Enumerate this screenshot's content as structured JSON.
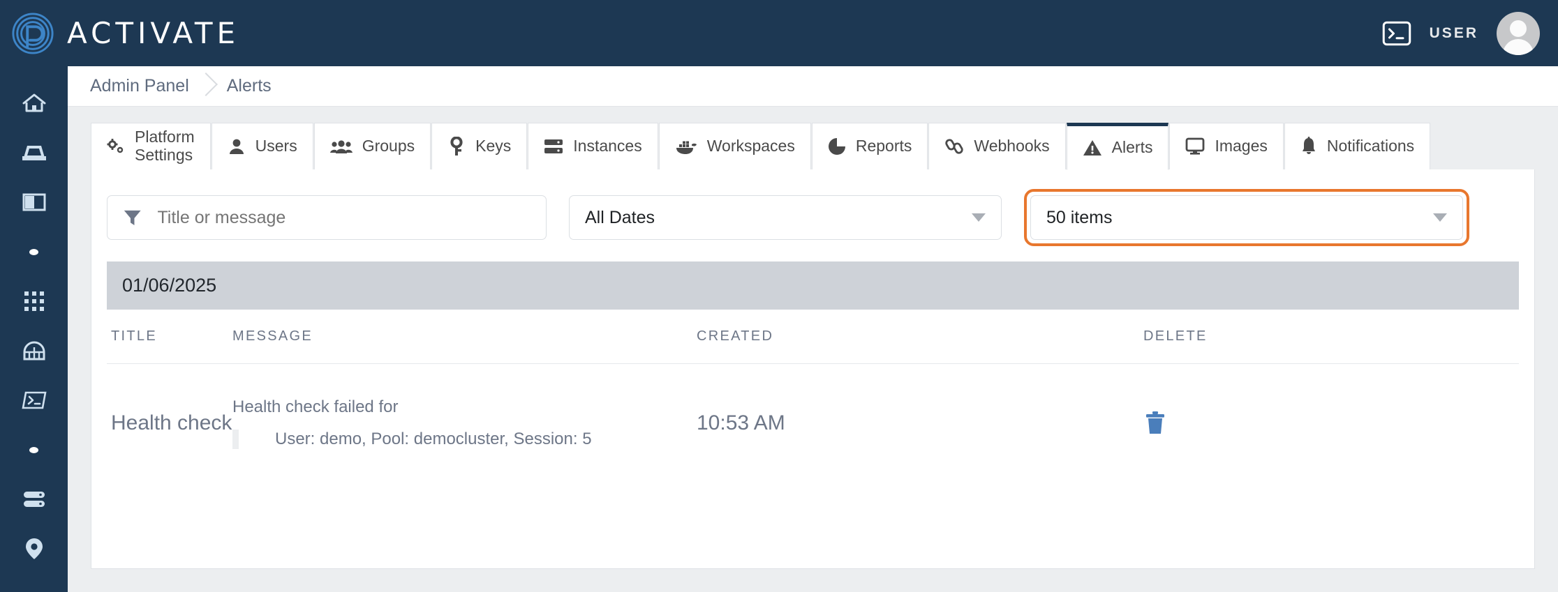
{
  "header": {
    "brand_name": "ACTIVATE",
    "logo_icon": "fingerprint-p-logo",
    "terminal_icon": "terminal-icon",
    "user_label": "USER",
    "avatar_icon": "user-avatar"
  },
  "sidebar": {
    "items": [
      {
        "name": "home",
        "icon": "home-icon"
      },
      {
        "name": "inbox",
        "icon": "inbox-tray-icon"
      },
      {
        "name": "panels",
        "icon": "panel-layout-icon"
      },
      {
        "name": "dot-1",
        "icon": "dot-icon"
      },
      {
        "name": "apps",
        "icon": "grid-apps-icon"
      },
      {
        "name": "gateway",
        "icon": "tunnel-arch-icon"
      },
      {
        "name": "terminal",
        "icon": "terminal-icon"
      },
      {
        "name": "dot-2",
        "icon": "dot-icon"
      },
      {
        "name": "servers",
        "icon": "server-stack-icon"
      },
      {
        "name": "location",
        "icon": "map-pin-icon"
      }
    ]
  },
  "breadcrumb": {
    "items": [
      "Admin Panel",
      "Alerts"
    ]
  },
  "tabs": [
    {
      "label": "Platform\nSettings",
      "icon": "cogs-icon",
      "active": false
    },
    {
      "label": "Users",
      "icon": "user-icon",
      "active": false
    },
    {
      "label": "Groups",
      "icon": "users-icon",
      "active": false
    },
    {
      "label": "Keys",
      "icon": "key-icon",
      "active": false
    },
    {
      "label": "Instances",
      "icon": "server-icon",
      "active": false
    },
    {
      "label": "Workspaces",
      "icon": "docker-icon",
      "active": false
    },
    {
      "label": "Reports",
      "icon": "pie-chart-icon",
      "active": false
    },
    {
      "label": "Webhooks",
      "icon": "link-icon",
      "active": false
    },
    {
      "label": "Alerts",
      "icon": "warning-icon",
      "active": true
    },
    {
      "label": "Images",
      "icon": "monitor-icon",
      "active": false
    },
    {
      "label": "Notifications",
      "icon": "bell-icon",
      "active": false
    }
  ],
  "filters": {
    "search": {
      "placeholder": "Title or message",
      "value": "",
      "icon": "filter-funnel-icon"
    },
    "date_select": {
      "value": "All Dates"
    },
    "page_size_select": {
      "value": "50 items",
      "highlighted": true,
      "highlight_color": "#e8772e"
    }
  },
  "table": {
    "date_group": "01/06/2025",
    "columns": [
      "TITLE",
      "MESSAGE",
      "CREATED",
      "DELETE"
    ],
    "rows": [
      {
        "title": "Health check",
        "message_line": "Health check failed for",
        "message_detail": "User: demo, Pool: democluster, Session: 5",
        "created": "10:53 AM",
        "delete_icon": "trash-icon"
      }
    ]
  },
  "colors": {
    "navy": "#1d3853",
    "accent_orange": "#e8772e",
    "trash_blue": "#4a7ebb",
    "band_gray": "#ced2d8",
    "text_gray": "#6d7687"
  }
}
